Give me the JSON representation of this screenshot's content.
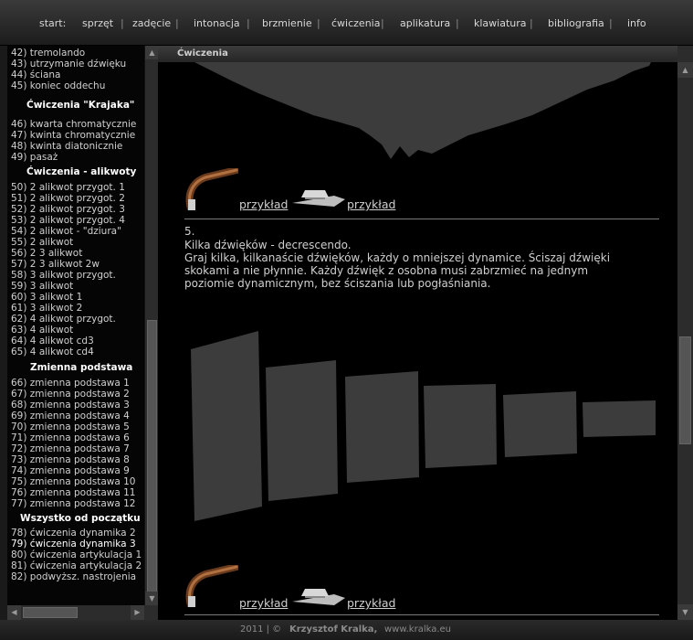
{
  "nav": {
    "start": "start:",
    "items": [
      "sprzęt",
      "zadęcie",
      "intonacja",
      "brzmienie",
      "ćwiczenia",
      "aplikatura",
      "klawiatura",
      "bibliografia",
      "info"
    ],
    "separator": "|"
  },
  "sidebar": {
    "items": [
      "42) tremolando",
      "43) utrzymanie dźwięku",
      "44) ściana",
      "45) koniec oddechu",
      "46) kwarta chromatycznie",
      "47) kwinta chromatycznie",
      "48) kwinta diatonicznie",
      "49) pasaż",
      "50) 2 alikwot przygot. 1",
      "51) 2 alikwot przygot. 2",
      "52) 2 alikwot przygot. 3",
      "53) 2 alikwot przygot. 4",
      "54) 2 alikwot - \"dziura\"",
      "55) 2 alikwot",
      "56) 2 3 alikwot",
      "57) 2 3 alikwot 2w",
      "58) 3 alikwot przygot.",
      "59) 3 alikwot",
      "60) 3 alikwot 1",
      "61) 3 alikwot 2",
      "62) 4 alikwot przygot.",
      "63) 4 alikwot",
      "64) 4 alikwot cd3",
      "65) 4 alikwot cd4",
      "66) zmienna podstawa 1",
      "67) zmienna podstawa 2",
      "68) zmienna podstawa 3",
      "69) zmienna podstawa 4",
      "70) zmienna podstawa 5",
      "71) zmienna podstawa 6",
      "72) zmienna podstawa 7",
      "73) zmienna podstawa 8",
      "74) zmienna podstawa 9",
      "75) zmienna podstawa 10",
      "76) zmienna podstawa 11",
      "77) zmienna podstawa 12",
      "78) ćwiczenia dynamika 2",
      "79) ćwiczenia dynamika 3",
      "80) ćwiczenia artykulacja 1",
      "81) ćwiczenia artykulacja 2",
      "82) podwyższ. nastrojenia"
    ],
    "headings": [
      "Ćwiczenia \"Krajaka\"",
      "Ćwiczenia - alikwoty",
      "Zmienna podstawa",
      "Wszystko od początku"
    ]
  },
  "main": {
    "title": "Ćwiczenia",
    "link_label": "przykład",
    "exercise": {
      "number": "5.",
      "title": "Kilka dźwięków - decrescendo.",
      "description": "Graj kilka, kilkanaście dźwięków, każdy o mniejszej dynamice. Ściszaj dźwięki skokami a nie płynnie. Każdy dźwięk z osobna musi zabrzmieć na jednym poziomie dynamicznym, bez ściszania lub pogłaśniania."
    }
  },
  "footer": {
    "year": "2011 | ©",
    "author": "Krzysztof Kralka,",
    "site": "www.kralka.eu"
  },
  "colors": {
    "background": "#000000",
    "waveform": "#3c3c3c",
    "text": "#cfcfcf"
  }
}
